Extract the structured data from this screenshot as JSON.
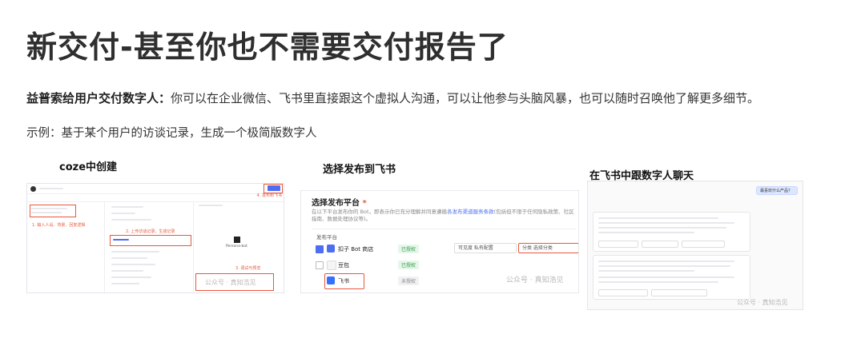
{
  "title": "新交付-甚至你也不需要交付报告了",
  "intro": {
    "bold": "益普索给用户交付数字人：",
    "text": "你可以在企业微信、飞书里直接跟这个虚拟人沟通，可以让他参与头脑风暴，也可以随时召唤他了解更多细节。"
  },
  "example": "示例：基于某个用户的访谈记录，生成一个极简版数字人",
  "captions": {
    "coze": "coze中创建",
    "publish": "选择发布到飞书",
    "chat": "在飞书中跟数字人聊天"
  },
  "panel_publish": {
    "heading": "选择发布平台",
    "required_mark": "*",
    "desc_prefix": "在以下平台发布你的 Bot，即表示你已充分理解并同意遵循",
    "desc_link": "各发布渠道服务条款",
    "desc_suffix": "(包括但不限于任何隐私政策、社区指南、数据处理协议等)。",
    "table_header": "发布平台",
    "rows": [
      {
        "name": "扣子 Bot 商店",
        "status": "已授权",
        "checked": true,
        "visibility": "可见度  私有配置",
        "category": "分类  选择分类"
      },
      {
        "name": "豆包",
        "status": "已授权",
        "checked": false
      },
      {
        "name": "飞书",
        "status": "未授权",
        "checked": true
      }
    ]
  },
  "panel_coze": {
    "annotation_publish": "4. 发布到飞书",
    "annotation_input": "1. 输入人设、背景、回复逻辑",
    "annotation_upload": "2. 上传访谈记录，生成记录",
    "annotation_run": "3. 调试与预览",
    "persona": "Persona-bot"
  },
  "panel_chat": {
    "user_msg": "最喜欢什么产品？",
    "chips": [
      "你可以回答一下哪些问题？",
      "你需要什么帮助？",
      "还有其他问题吗？"
    ]
  },
  "watermark": "公众号 · 真知浩见",
  "colors": {
    "accent": "#4e6ef2",
    "annotation": "#e8583d",
    "ok": "#2ea043"
  }
}
